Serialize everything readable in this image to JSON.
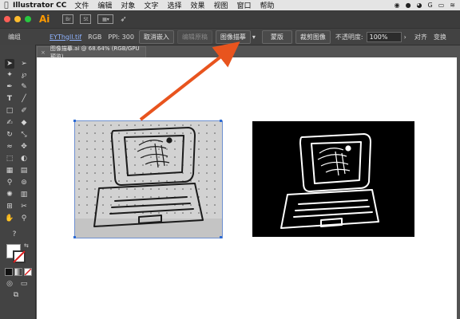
{
  "menubar": {
    "app_name": "Illustrator CC",
    "items": [
      "文件",
      "编辑",
      "对象",
      "文字",
      "选择",
      "效果",
      "视图",
      "窗口",
      "帮助"
    ]
  },
  "appbar": {
    "logo": "Ai",
    "icons": [
      "Br",
      "St"
    ]
  },
  "control_bar": {
    "mode_label": "编组",
    "file_name": "EYThgll.tif",
    "color_mode": "RGB",
    "ppi": "PPI: 300",
    "cancel_embed": "取消嵌入",
    "edit_original": "编辑原稿",
    "image_trace": "图像描摹",
    "mask": "蒙版",
    "crop_image": "裁剪图像",
    "opacity_label": "不透明度:",
    "opacity_value": "100%",
    "align": "对齐",
    "transform": "变换"
  },
  "document": {
    "tab_title": "图像描摹.ai @ 68.64% (RGB/GPU 预览)"
  },
  "colors": {
    "annotation_arrow": "#e8541e",
    "selection": "#2d6bd4",
    "canvas": "#ffffff"
  }
}
